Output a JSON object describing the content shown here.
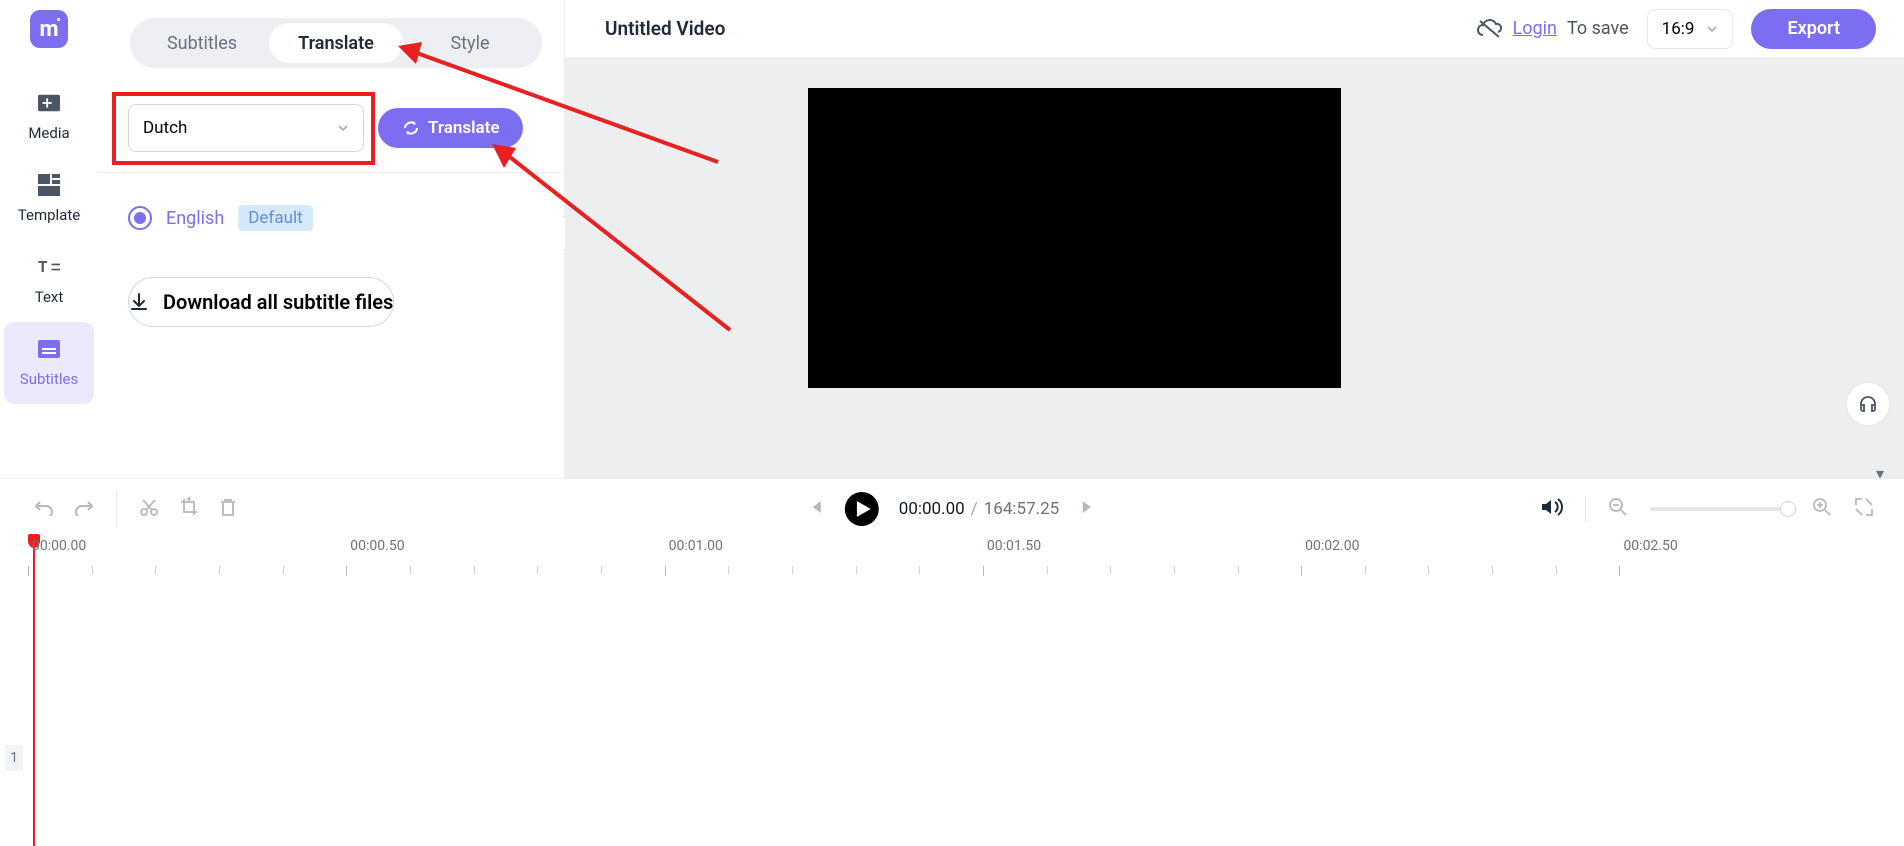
{
  "sidebar": {
    "items": [
      {
        "label": "Media"
      },
      {
        "label": "Template"
      },
      {
        "label": "Text"
      },
      {
        "label": "Subtitles"
      }
    ]
  },
  "tabs": {
    "subtitles": "Subtitles",
    "translate": "Translate",
    "style": "Style"
  },
  "translate": {
    "selected_language": "Dutch",
    "button": "Translate"
  },
  "language_list": {
    "name": "English",
    "badge": "Default"
  },
  "download_button": "Download all subtitle files",
  "header": {
    "title": "Untitled Video",
    "login": "Login",
    "to_save": "To save",
    "aspect": "16:9",
    "export": "Export"
  },
  "player": {
    "current": "00:00.00",
    "separator": "/",
    "duration": "164:57.25"
  },
  "ruler": {
    "labels": [
      "00:00.00",
      "00:00.50",
      "00:01.00",
      "00:01.50",
      "00:02.00",
      "00:02.50"
    ]
  },
  "track": {
    "index": "1"
  }
}
